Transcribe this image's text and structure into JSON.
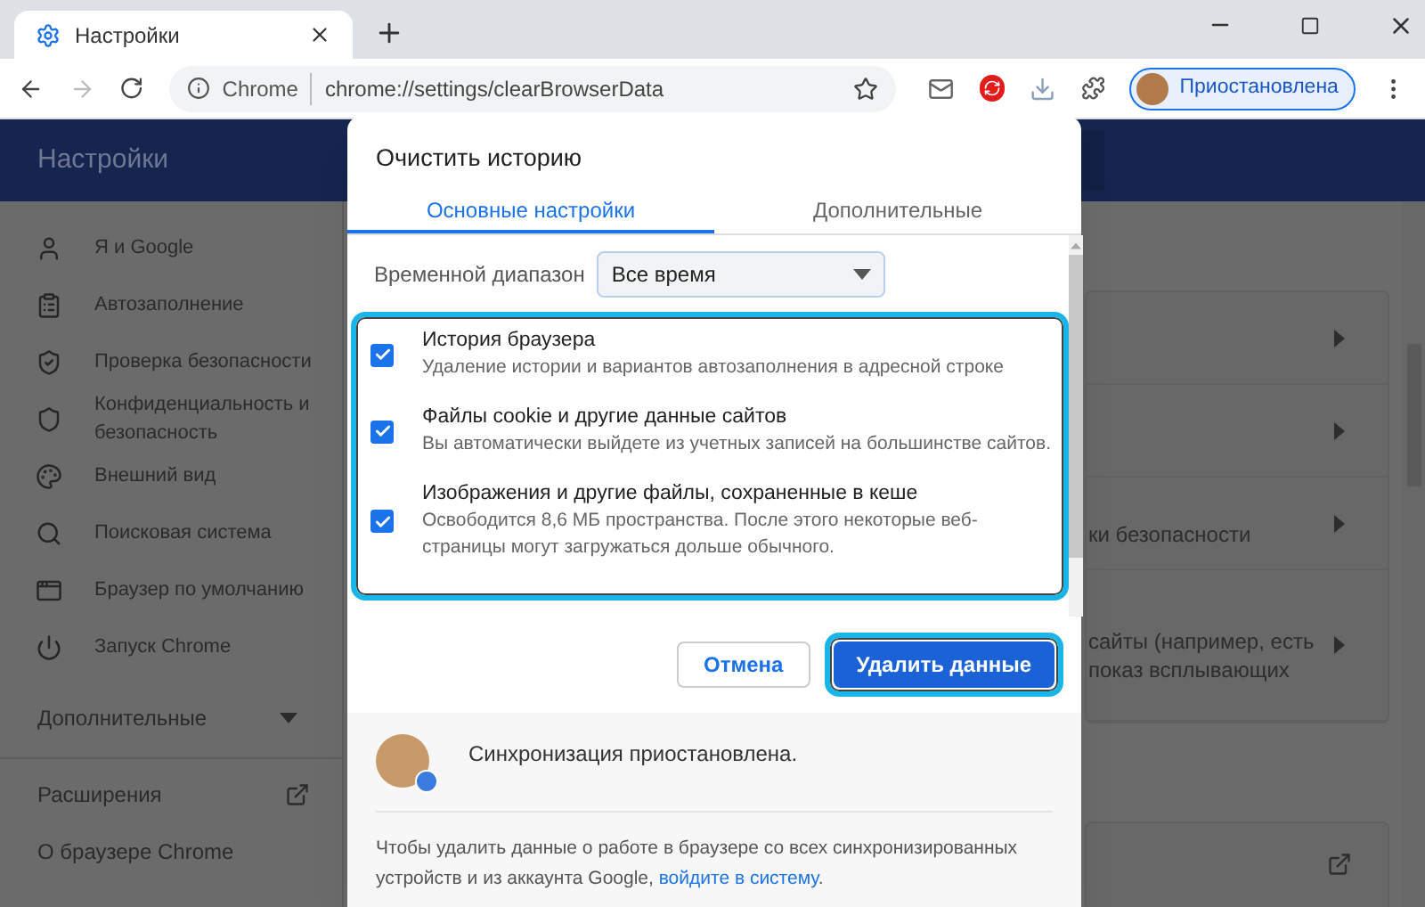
{
  "browser": {
    "tab": {
      "title": "Настройки"
    },
    "address": {
      "site_label": "Chrome",
      "url": "chrome://settings/clearBrowserData"
    },
    "profile": {
      "label": "Приостановлена"
    }
  },
  "settings": {
    "header": "Настройки",
    "sidebar": {
      "items": [
        {
          "label": "Я и Google"
        },
        {
          "label": "Автозаполнение"
        },
        {
          "label": "Проверка безопасности"
        },
        {
          "label": "Конфиденциальность и безопасность"
        },
        {
          "label": "Внешний вид"
        },
        {
          "label": "Поисковая система"
        },
        {
          "label": "Браузер по умолчанию"
        },
        {
          "label": "Запуск Chrome"
        }
      ],
      "advanced": "Дополнительные",
      "links": [
        {
          "label": "Расширения",
          "kind": "external"
        },
        {
          "label": "О браузере Chrome",
          "kind": "plain"
        }
      ]
    },
    "background_rows": [
      {
        "lines": []
      },
      {
        "lines": []
      },
      {
        "lines": [
          "ки безопасности"
        ]
      },
      {
        "lines": [
          "сайты (например, есть",
          "показ всплывающих"
        ]
      }
    ]
  },
  "dialog": {
    "title": "Очистить историю",
    "tabs": [
      {
        "label": "Основные настройки",
        "selected": true
      },
      {
        "label": "Дополнительные",
        "selected": false
      }
    ],
    "time_range": {
      "label": "Временной диапазон",
      "value": "Все время"
    },
    "options": [
      {
        "title": "История браузера",
        "description": "Удаление истории и вариантов автозаполнения в адресной строке",
        "checked": true
      },
      {
        "title": "Файлы cookie и другие данные сайтов",
        "description": "Вы автоматически выйдете из учетных записей на большинстве сайтов.",
        "checked": true
      },
      {
        "title": "Изображения и другие файлы, сохраненные в кеше",
        "description": "Освободится 8,6 МБ пространства. После этого некоторые веб-страницы могут загружаться дольше обычного.",
        "checked": true
      }
    ],
    "cancel": "Отмена",
    "confirm": "Удалить данные",
    "sync": {
      "status": "Синхронизация приостановлена."
    },
    "footer": {
      "text": "Чтобы удалить данные о работе в браузере со всех синхронизированных устройств и из аккаунта Google,",
      "link": "войдите в систему",
      "end": "."
    }
  }
}
